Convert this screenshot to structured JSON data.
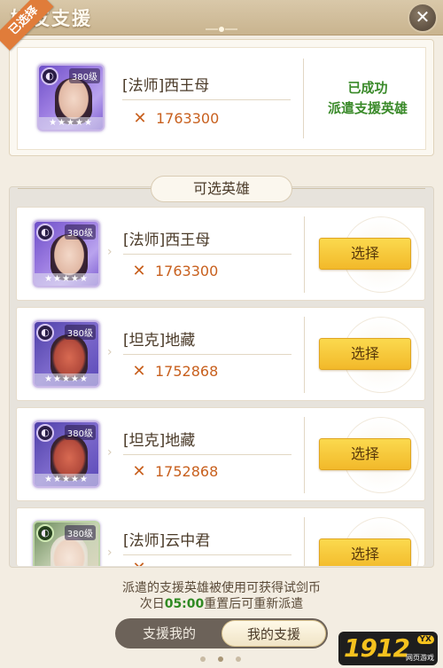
{
  "header": {
    "title": "好友支援",
    "close_icon": "close-icon"
  },
  "selected": {
    "ribbon": "已选择",
    "hero": {
      "class_icon": "mage-class-icon",
      "level": "380级",
      "name": "[法师]西王母",
      "power": "1763300",
      "stars": "★★★★★"
    },
    "status_line1": "已成功",
    "status_line2": "派遣支援英雄"
  },
  "section": {
    "title": "可选英雄"
  },
  "heroes": [
    {
      "level": "380级",
      "name": "[法师]西王母",
      "power": "1763300",
      "stars": "★★★★★",
      "button": "选择"
    },
    {
      "level": "380级",
      "name": "[坦克]地藏",
      "power": "1752868",
      "stars": "★★★★★",
      "button": "选择"
    },
    {
      "level": "380级",
      "name": "[坦克]地藏",
      "power": "1752868",
      "stars": "★★★★★",
      "button": "选择"
    },
    {
      "level": "380级",
      "name": "[法师]云中君",
      "power": "",
      "stars": "★★★★★",
      "button": "选择"
    }
  ],
  "footer": {
    "note_line1": "派遣的支援英雄被使用可获得试剑币",
    "note_line2_prefix": "次日",
    "note_line2_time": "05:00",
    "note_line2_suffix": "重置后可重新派遣",
    "tab_left": "支援我的",
    "tab_right": "我的支援"
  },
  "watermark": {
    "main": "1912",
    "badge": "YX",
    "sub": "网页游戏"
  },
  "colors": {
    "accent_orange": "#c8601e",
    "status_green": "#3a8a2a",
    "button_yellow": "#f2b92a"
  }
}
